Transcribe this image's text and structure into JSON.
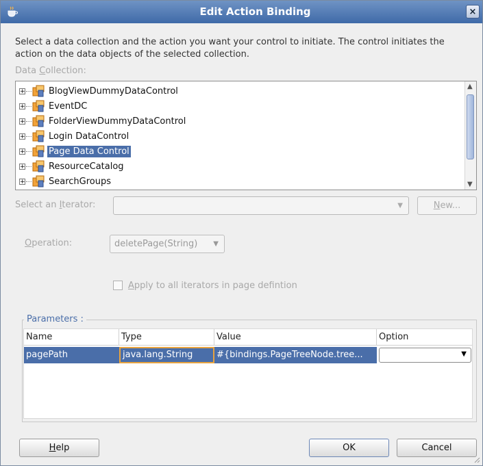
{
  "window": {
    "title": "Edit Action Binding",
    "close_glyph": "×"
  },
  "description": "Select a data collection and the action you want your control to initiate. The control initiates the action on the data objects of the selected collection.",
  "data_collection": {
    "label_pre": "Data ",
    "label_mnemonic": "C",
    "label_post": "ollection:",
    "items": [
      {
        "label": "BlogViewDummyDataControl",
        "selected": false
      },
      {
        "label": "EventDC",
        "selected": false
      },
      {
        "label": "FolderViewDummyDataControl",
        "selected": false
      },
      {
        "label": "Login DataControl",
        "selected": false
      },
      {
        "label": "Page Data Control",
        "selected": true
      },
      {
        "label": "ResourceCatalog",
        "selected": false
      },
      {
        "label": "SearchGroups",
        "selected": false
      }
    ]
  },
  "iterator": {
    "label_pre": "Select an ",
    "label_mnemonic": "I",
    "label_post": "terator:",
    "value": "",
    "new_button_mnemonic": "N",
    "new_button_rest": "ew..."
  },
  "operation": {
    "label_mnemonic": "O",
    "label_post": "peration:",
    "value": "deletePage(String)"
  },
  "apply_all": {
    "mnemonic": "A",
    "rest": "pply to all iterators in page defintion",
    "checked": false
  },
  "parameters": {
    "legend": "Parameters :",
    "columns": [
      "Name",
      "Type",
      "Value",
      "Option"
    ],
    "rows": [
      {
        "name": "pagePath",
        "type": "java.lang.String",
        "value": "#{bindings.PageTreeNode.tree...",
        "option": ""
      }
    ]
  },
  "buttons": {
    "help_mnemonic": "H",
    "help_rest": "elp",
    "ok": "OK",
    "cancel": "Cancel"
  },
  "colors": {
    "selection": "#4a6ea9",
    "titlebar": "#3f6aa8",
    "edit_border": "#e8a33f"
  },
  "icons": [
    "java-cup-icon",
    "close-icon",
    "expand-plus-icon",
    "data-control-icon",
    "chevron-down-icon",
    "scroll-up-icon",
    "scroll-down-icon",
    "resize-grip-icon"
  ]
}
